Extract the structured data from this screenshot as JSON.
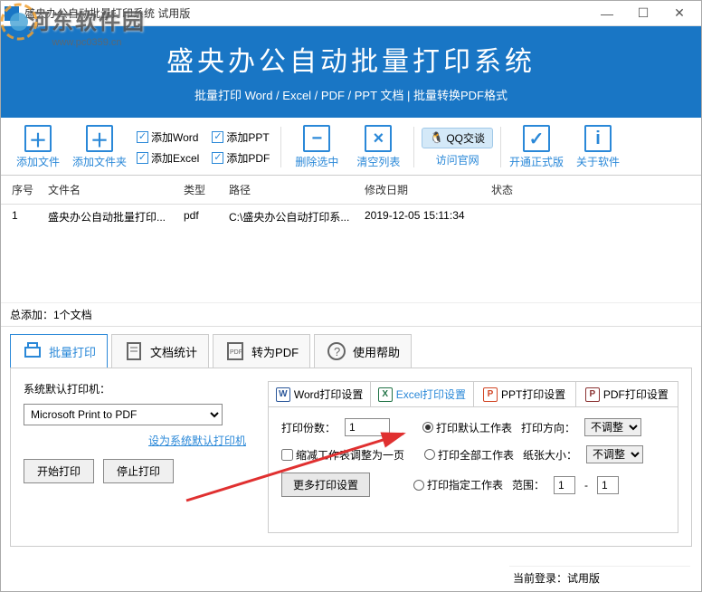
{
  "window": {
    "title": "盛央办公自动批量打印系统 试用版"
  },
  "watermark": {
    "text": "河东软件园",
    "url": "www.pc0359.cn"
  },
  "header": {
    "title": "盛央办公自动批量打印系统",
    "subtitle": "批量打印 Word / Excel / PDF / PPT 文档  |  批量转换PDF格式"
  },
  "toolbar": {
    "add_file": "添加文件",
    "add_folder": "添加文件夹",
    "chk_word": "添加Word",
    "chk_excel": "添加Excel",
    "chk_ppt": "添加PPT",
    "chk_pdf": "添加PDF",
    "delete_selected": "删除选中",
    "clear_list": "清空列表",
    "qq": "QQ交谈",
    "official": "访问官网",
    "activate": "开通正式版",
    "about": "关于软件"
  },
  "table": {
    "headers": {
      "idx": "序号",
      "name": "文件名",
      "type": "类型",
      "path": "路径",
      "date": "修改日期",
      "status": "状态"
    },
    "rows": [
      {
        "idx": "1",
        "name": "盛央办公自动批量打印...",
        "type": "pdf",
        "path": "C:\\盛央办公自动打印系...",
        "date": "2019-12-05 15:11:34",
        "status": ""
      }
    ]
  },
  "summary": "总添加：1个文档",
  "tabs": {
    "batch_print": "批量打印",
    "doc_stats": "文档统计",
    "to_pdf": "转为PDF",
    "help": "使用帮助"
  },
  "printer": {
    "label": "系统默认打印机：",
    "selected": "Microsoft Print to PDF",
    "set_default": "设为系统默认打印机",
    "start": "开始打印",
    "stop": "停止打印"
  },
  "subtabs": {
    "word": "Word打印设置",
    "excel": "Excel打印设置",
    "ppt": "PPT打印设置",
    "pdf": "PDF打印设置"
  },
  "settings": {
    "copies_label": "打印份数：",
    "copies_value": "1",
    "fit_page": "缩减工作表调整为一页",
    "more": "更多打印设置",
    "radio_default": "打印默认工作表",
    "radio_all": "打印全部工作表",
    "radio_range": "打印指定工作表",
    "orient_label": "打印方向：",
    "orient_value": "不调整",
    "size_label": "纸张大小：",
    "size_value": "不调整",
    "range_label": "范围：",
    "range_from": "1",
    "range_to": "1"
  },
  "statusbar": "当前登录：试用版"
}
